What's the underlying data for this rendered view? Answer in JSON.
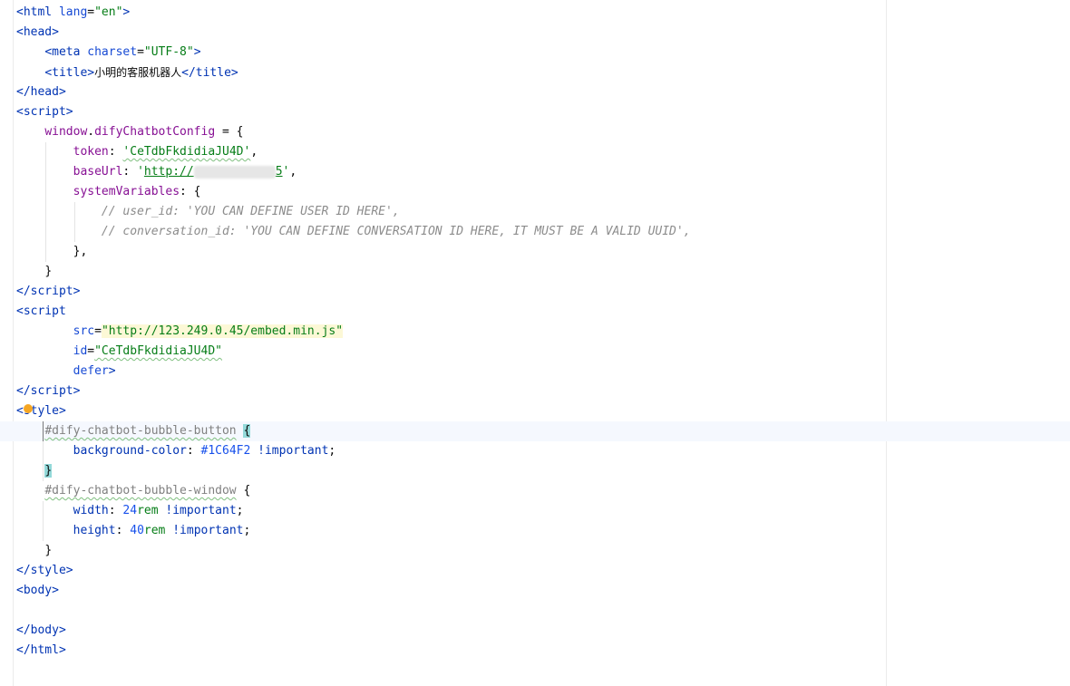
{
  "code": {
    "l1": {
      "open": "<",
      "tag": "html",
      "sp": " ",
      "attr": "lang",
      "eq": "=",
      "val": "\"en\"",
      "close": ">"
    },
    "l2": {
      "open": "<",
      "tag": "head",
      "close": ">"
    },
    "l3": {
      "indent": "    ",
      "open": "<",
      "tag": "meta",
      "sp": " ",
      "attr": "charset",
      "eq": "=",
      "val": "\"UTF-8\"",
      "close": ">"
    },
    "l4": {
      "indent": "    ",
      "open": "<",
      "tag": "title",
      "close": ">",
      "text": "小明的客服机器人",
      "end_open": "</",
      "end_tag": "title",
      "end_close": ">"
    },
    "l5": {
      "open": "</",
      "tag": "head",
      "close": ">"
    },
    "l6": {
      "open": "<",
      "tag": "script",
      "close": ">"
    },
    "l7": {
      "indent": "    ",
      "obj": "window",
      "dot": ".",
      "prop": "difyChatbotConfig",
      "rest": " = {"
    },
    "l8": {
      "indent": "        ",
      "key": "token",
      "colon": ": ",
      "val": "'CeTdbFkdidiaJU4D'",
      "comma": ","
    },
    "l9": {
      "indent": "        ",
      "key": "baseUrl",
      "colon": ": ",
      "q1": "'",
      "url1": "http://",
      "url2": "5",
      "q2": "'",
      "comma": ","
    },
    "l10": {
      "indent": "        ",
      "key": "systemVariables",
      "rest": ": {"
    },
    "l11": {
      "indent": "            ",
      "comment": "// user_id: 'YOU CAN DEFINE USER ID HERE',"
    },
    "l12": {
      "indent": "            ",
      "comment": "// conversation_id: 'YOU CAN DEFINE CONVERSATION ID HERE, IT MUST BE A VALID UUID',"
    },
    "l13": {
      "indent": "        ",
      "text": "},"
    },
    "l14": {
      "indent": "    ",
      "text": "}"
    },
    "l15": {
      "open": "</",
      "tag": "script",
      "close": ">"
    },
    "l16": {
      "open": "<",
      "tag": "script"
    },
    "l17": {
      "indent": "        ",
      "attr": "src",
      "eq": "=",
      "val": "\"http://123.249.0.45/embed.min.js\""
    },
    "l18": {
      "indent": "        ",
      "attr": "id",
      "eq": "=",
      "val": "\"CeTdbFkdidiaJU4D\""
    },
    "l19": {
      "indent": "        ",
      "attr": "defer",
      "close": ">"
    },
    "l20": {
      "open": "</",
      "tag": "script",
      "close": ">"
    },
    "l21": {
      "open": "<",
      "tag": "style",
      "close": ">"
    },
    "l22": {
      "indent": "    ",
      "selector": "#dify-chatbot-bubble-button",
      "sp": " ",
      "brace": "{"
    },
    "l23": {
      "indent": "        ",
      "prop": "background-color",
      "colon": ": ",
      "val": "#1C64F2",
      "sp": " ",
      "imp": "!important",
      "semi": ";"
    },
    "l24": {
      "indent": "    ",
      "brace": "}"
    },
    "l25": {
      "indent": "    ",
      "selector": "#dify-chatbot-bubble-window",
      "rest": " {"
    },
    "l26": {
      "indent": "        ",
      "prop": "width",
      "colon": ": ",
      "num": "24",
      "unit": "rem",
      "sp": " ",
      "imp": "!important",
      "semi": ";"
    },
    "l27": {
      "indent": "        ",
      "prop": "height",
      "colon": ": ",
      "num": "40",
      "unit": "rem",
      "sp": " ",
      "imp": "!important",
      "semi": ";"
    },
    "l28": {
      "indent": "    ",
      "text": "}"
    },
    "l29": {
      "open": "</",
      "tag": "style",
      "close": ">"
    },
    "l30": {
      "open": "<",
      "tag": "body",
      "close": ">"
    },
    "l31": {
      "text": ""
    },
    "l32": {
      "open": "</",
      "tag": "body",
      "close": ">"
    },
    "l33": {
      "open": "</",
      "tag": "html",
      "close": ">"
    }
  },
  "colors": {
    "background": "#ffffff",
    "current_line": "#f5f8fe",
    "tag": "#0033b3",
    "string": "#067d17",
    "comment": "#8c8c8c",
    "warning_dot": "#f5a623"
  },
  "icons": {
    "warning": "warning-dot-icon"
  }
}
